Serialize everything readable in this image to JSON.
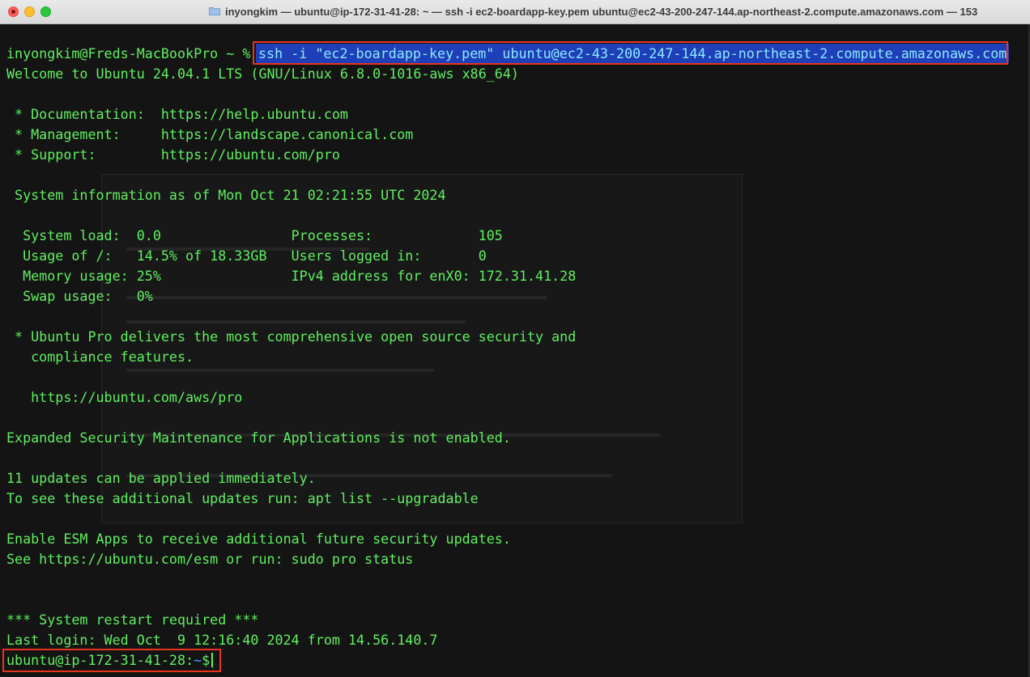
{
  "window": {
    "title": "inyongkim — ubuntu@ip-172-31-41-28: ~ — ssh -i ec2-boardapp-key.pem ubuntu@ec2-43-200-247-144.ap-northeast-2.compute.amazonaws.com — 153"
  },
  "terminal": {
    "first_prompt": "inyongkim@Freds-MacBookPro ~ % ",
    "command": "ssh -i \"ec2-boardapp-key.pem\" ubuntu@ec2-43-200-247-144.ap-northeast-2.compute.amazonaws.com",
    "lines": [
      "Welcome to Ubuntu 24.04.1 LTS (GNU/Linux 6.8.0-1016-aws x86_64)",
      "",
      " * Documentation:  https://help.ubuntu.com",
      " * Management:     https://landscape.canonical.com",
      " * Support:        https://ubuntu.com/pro",
      "",
      " System information as of Mon Oct 21 02:21:55 UTC 2024",
      "",
      "  System load:  0.0                Processes:             105",
      "  Usage of /:   14.5% of 18.33GB   Users logged in:       0",
      "  Memory usage: 25%                IPv4 address for enX0: 172.31.41.28",
      "  Swap usage:   0%",
      "",
      " * Ubuntu Pro delivers the most comprehensive open source security and",
      "   compliance features.",
      "",
      "   https://ubuntu.com/aws/pro",
      "",
      "Expanded Security Maintenance for Applications is not enabled.",
      "",
      "11 updates can be applied immediately.",
      "To see these additional updates run: apt list --upgradable",
      "",
      "Enable ESM Apps to receive additional future security updates.",
      "See https://ubuntu.com/esm or run: sudo pro status",
      "",
      "",
      "*** System restart required ***",
      "Last login: Wed Oct  9 12:16:40 2024 from 14.56.140.7"
    ],
    "final_prompt_user": "ubuntu@ip-172-31-41-28:",
    "final_prompt_dir": "~",
    "final_prompt_symbol": "$"
  },
  "colors": {
    "text": "#5ff05f",
    "highlight_border": "#e8341c",
    "selection_bg": "#1e3fb8",
    "selection_text": "#8ee8ff"
  },
  "icons": {
    "title_icon": "folder-icon"
  }
}
